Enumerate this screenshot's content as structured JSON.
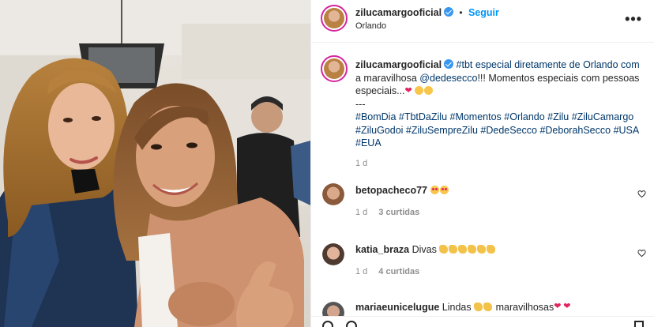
{
  "post": {
    "author": "zilucamargooficial",
    "follow_label": "Seguir",
    "location": "Orlando",
    "more_label": "•••"
  },
  "caption": {
    "author": "zilucamargooficial",
    "line1": "#tbt especial diretamente de Orlando com",
    "line2_prefix": "a maravilhosa ",
    "mention": "@dedesecco",
    "line2_suffix": "!!! Momentos especiais com pessoas",
    "line3": "especiais...",
    "separator": "---",
    "hashtags_line1": "#BomDia #TbtDaZilu #Momentos #Orlando #Zilu #ZiluCamargo",
    "hashtags_line2": "#ZiluGodoi #ZiluSempreZilu #DedeSecco #DeborahSecco #USA",
    "hashtags_line3": "#EUA",
    "time": "1 d"
  },
  "comments": [
    {
      "user": "betopacheco77",
      "text": "",
      "emoji": "hearteyes",
      "emoji_count": 2,
      "time": "1 d",
      "likes": "3 curtidas"
    },
    {
      "user": "katia_braza",
      "text": "Divas",
      "emoji": "clap",
      "emoji_count": 6,
      "time": "1 d",
      "likes": "4 curtidas"
    },
    {
      "user": "mariaeunicelugue",
      "text": "Lindas",
      "text2": "maravilhosas",
      "emoji": "clap",
      "emoji_count": 2,
      "emoji2": "heart",
      "emoji2_count": 2
    }
  ],
  "colors": {
    "link": "#00376b",
    "follow": "#0095f6",
    "muted": "#8e8e8e",
    "verified": "#3897f0"
  },
  "icons": [
    "verified-badge-icon",
    "more-options-icon",
    "heart-icon",
    "hearteyes-emoji-icon",
    "clap-emoji-icon",
    "heart-emoji-icon"
  ]
}
